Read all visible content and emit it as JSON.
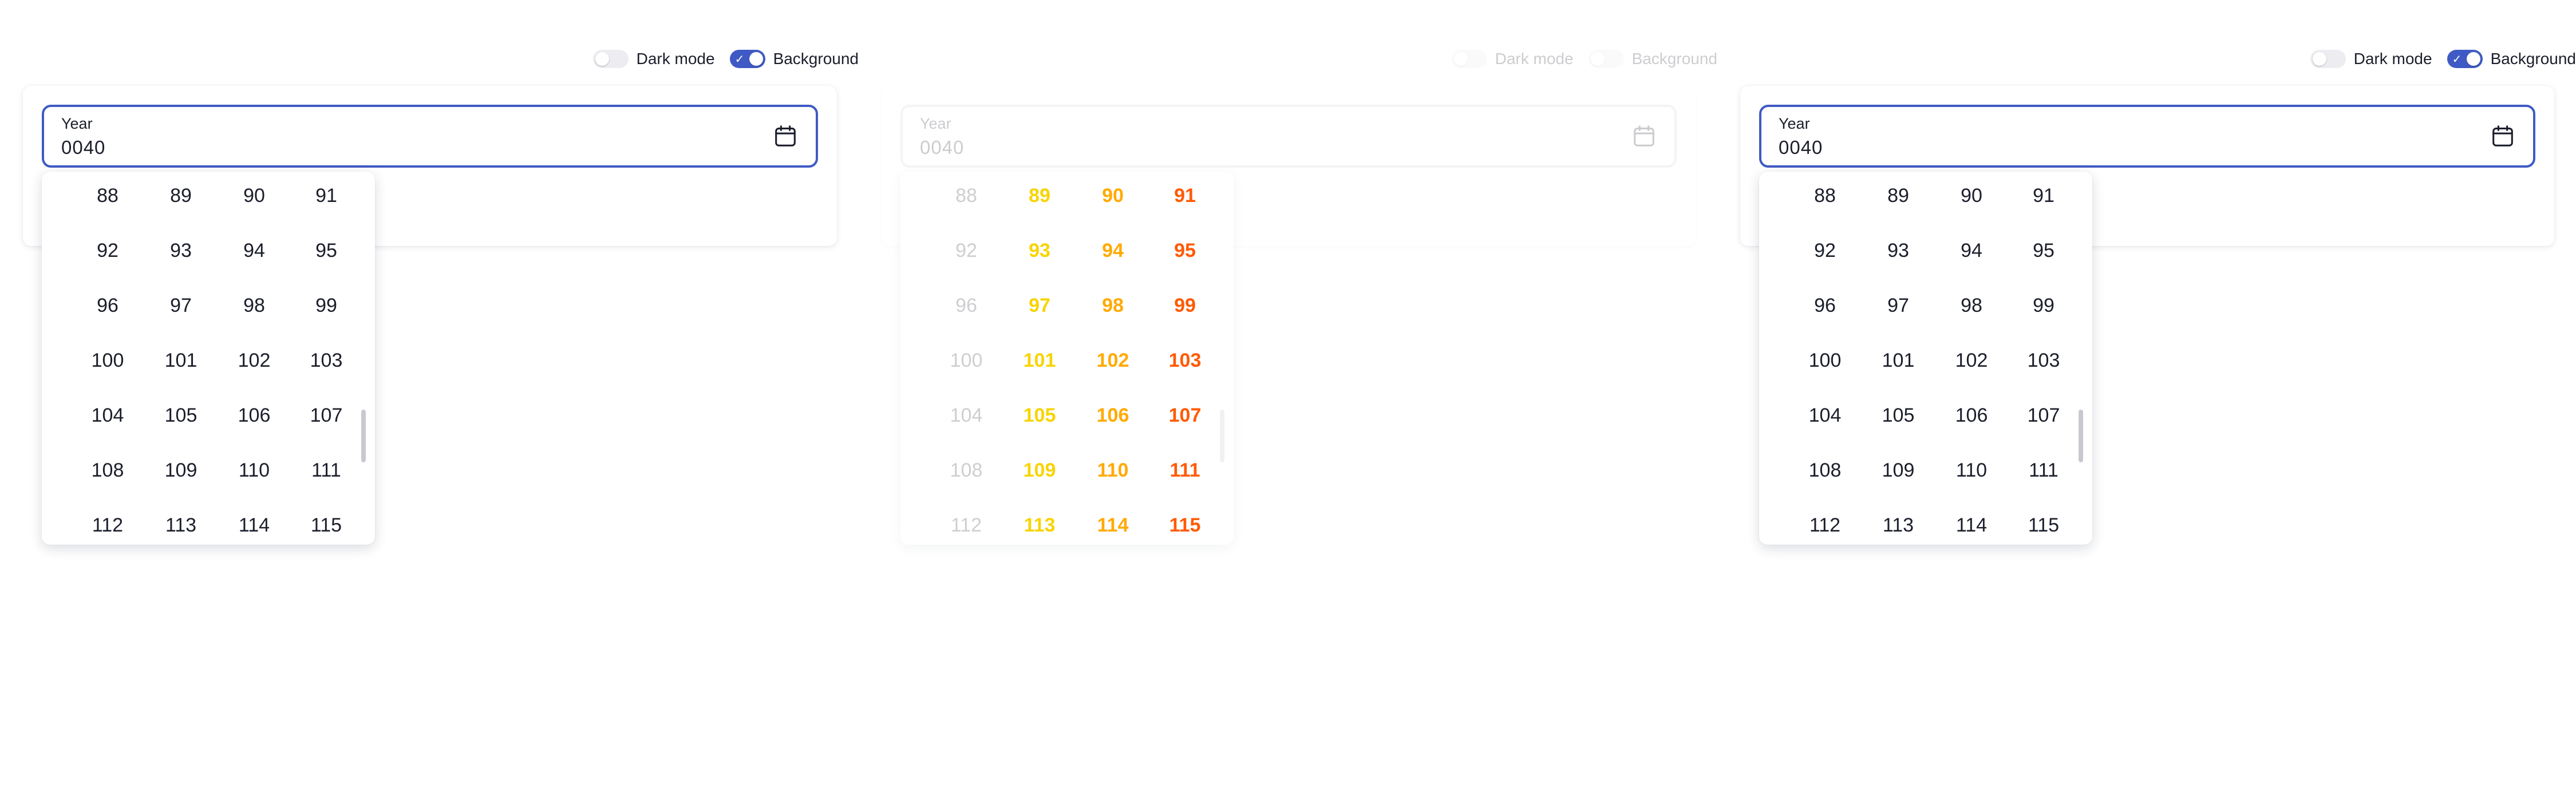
{
  "panels": [
    {
      "dark_mode_label": "Dark mode",
      "background_label": "Background",
      "field": {
        "label": "Year",
        "value": "0040"
      },
      "year_options": [
        "88",
        "89",
        "90",
        "91",
        "92",
        "93",
        "94",
        "95",
        "96",
        "97",
        "98",
        "99",
        "100",
        "101",
        "102",
        "103",
        "104",
        "105",
        "106",
        "107",
        "108",
        "109",
        "110",
        "111",
        "112",
        "113",
        "114",
        "115"
      ]
    },
    {
      "dark_mode_label": "Dark mode",
      "background_label": "Background",
      "field": {
        "label": "Year",
        "value": "0040"
      },
      "year_options": [
        "88",
        "89",
        "90",
        "91",
        "92",
        "93",
        "94",
        "95",
        "96",
        "97",
        "98",
        "99",
        "100",
        "101",
        "102",
        "103",
        "104",
        "105",
        "106",
        "107",
        "108",
        "109",
        "110",
        "111",
        "112",
        "113",
        "114",
        "115"
      ]
    },
    {
      "dark_mode_label": "Dark mode",
      "background_label": "Background",
      "field": {
        "label": "Year",
        "value": "0040"
      },
      "year_options": [
        "88",
        "89",
        "90",
        "91",
        "92",
        "93",
        "94",
        "95",
        "96",
        "97",
        "98",
        "99",
        "100",
        "101",
        "102",
        "103",
        "104",
        "105",
        "106",
        "107",
        "108",
        "109",
        "110",
        "111",
        "112",
        "113",
        "114",
        "115"
      ]
    }
  ],
  "toggles": {
    "dark_mode_on": false,
    "background_on": true
  },
  "colors": {
    "accent": "#3f5ac4",
    "text": "#1b1e2b",
    "glitch_yellow": "#f7d400",
    "glitch_orange": "#ffaa00",
    "glitch_red": "#ff5a00"
  },
  "icons": {
    "field_icon": "calendar-icon",
    "check_icon": "check-icon"
  }
}
